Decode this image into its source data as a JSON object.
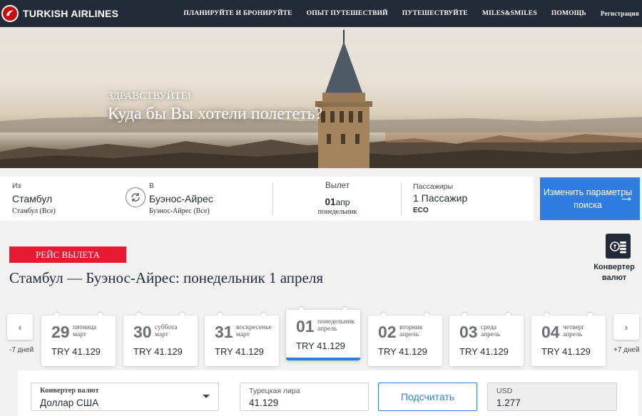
{
  "brand": {
    "name": "TURKISH AIRLINES",
    "color": "#c90c0f"
  },
  "nav": {
    "items": [
      "ПЛАНИРУЙТЕ И БРОНИРУЙТЕ",
      "ОПЫТ ПУТЕШЕСТВИЙ",
      "ПУТЕШЕСТВУЙТЕ",
      "MILES&SMILES",
      "ПОМОЩЬ"
    ],
    "register": "Регистрация"
  },
  "hero": {
    "greeting": "ЗДРАВСТВУЙТЕ!",
    "title": "Куда бы Вы хотели полететь?"
  },
  "search": {
    "from": {
      "label": "Из",
      "city": "Стамбул",
      "sub": "Стамбул (Все)"
    },
    "to": {
      "label": "В",
      "city": "Буэнос-Айрес",
      "sub": "Буэнос-Айрес (Все)"
    },
    "depart": {
      "label": "Вылет",
      "day": "01",
      "month": "апр",
      "weekday": "понедельник"
    },
    "passengers": {
      "label": "Пассажиры",
      "value": "1 Пассажир",
      "class": "ECO"
    },
    "cta": "Изменить параметры поиска"
  },
  "results": {
    "badge": "РЕЙС ВЫЛЕТА",
    "title": "Стамбул — Буэнос-Айрес: понедельник 1 апреля",
    "converter_label": "Конвертер валют",
    "prev_caption": "-7 дней",
    "next_caption": "+7 дней",
    "days": [
      {
        "num": "29",
        "weekday": "пятница",
        "month": "март",
        "price": "TRY 41.129"
      },
      {
        "num": "30",
        "weekday": "суббота",
        "month": "март",
        "price": "TRY 41.129"
      },
      {
        "num": "31",
        "weekday": "воскресенье",
        "month": "март",
        "price": "TRY 41.129"
      },
      {
        "num": "01",
        "weekday": "понедельник",
        "month": "апрель",
        "price": "TRY 41.129",
        "selected": true
      },
      {
        "num": "02",
        "weekday": "вторник",
        "month": "апрель",
        "price": "TRY 41.129"
      },
      {
        "num": "03",
        "weekday": "среда",
        "month": "апрель",
        "price": "TRY 41.129"
      },
      {
        "num": "04",
        "weekday": "четверг",
        "month": "апрель",
        "price": "TRY 41.129"
      }
    ]
  },
  "converter": {
    "select_label": "Конвертер валют",
    "select_value": "Доллар США",
    "amount_label": "Турецкая лира",
    "amount_value": "41.129",
    "calc_button": "Подсчитать",
    "result_label": "USD",
    "result_value": "1.277"
  },
  "colors": {
    "nav_bg": "#232b38",
    "accent": "#2f7de1",
    "badge": "#e81932"
  }
}
